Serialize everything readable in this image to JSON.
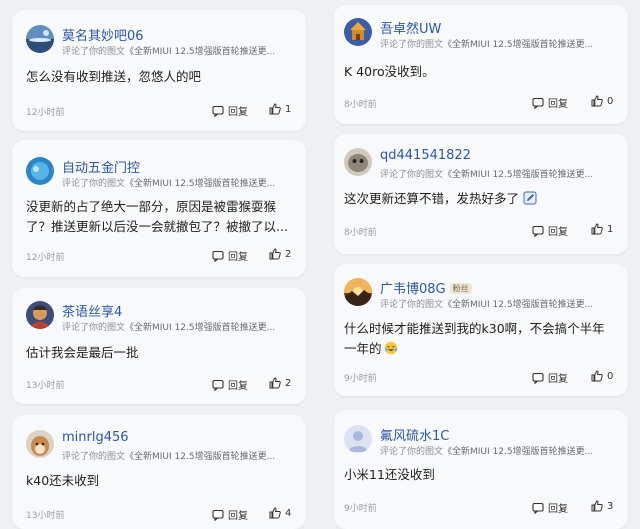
{
  "actions": {
    "reply_label": "回复"
  },
  "comments": [
    {
      "username": "莫名其妙吧06",
      "subline_prefix": "评论了你的图文",
      "subline_quote": "《全新MIUI 12.5增强版首轮推送更...",
      "text_lines": [
        "怎么没有收到推送，忽悠人的吧"
      ],
      "time": "12小时前",
      "likes": "1",
      "badge": ""
    },
    {
      "username": "吾卓然UW",
      "subline_prefix": "评论了你的图文",
      "subline_quote": "《全新MIUI 12.5增强版首轮推送更...",
      "text_lines": [
        "K 40ro没收到。"
      ],
      "time": "8小时前",
      "likes": "0",
      "badge": ""
    },
    {
      "username": "自动五金门控",
      "subline_prefix": "评论了你的图文",
      "subline_quote": "《全新MIUI 12.5增强版首轮推送更...",
      "text_lines": [
        "没更新的占了绝大一部分，原因是被雷猴耍猴",
        "了？推送更新以后没一会就撤包了？被撤了以..."
      ],
      "time": "12小时前",
      "likes": "2",
      "badge": ""
    },
    {
      "username": "qd441541822",
      "subline_prefix": "评论了你的图文",
      "subline_quote": "《全新MIUI 12.5增强版首轮推送更...",
      "text_lines": [
        "这次更新还算不错，发热好多了"
      ],
      "time": "8小时前",
      "likes": "1",
      "badge": ""
    },
    {
      "username": "茶语丝享4",
      "subline_prefix": "评论了你的图文",
      "subline_quote": "《全新MIUI 12.5增强版首轮推送更...",
      "text_lines": [
        "估计我会是最后一批"
      ],
      "time": "13小时前",
      "likes": "2",
      "badge": ""
    },
    {
      "username": "广韦博08G",
      "subline_prefix": "评论了你的图文",
      "subline_quote": "《全新MIUI 12.5增强版首轮推送更...",
      "text_lines": [
        "什么时候才能推送到我的k30啊，不会搞个半年",
        "一年的"
      ],
      "time": "9小时前",
      "likes": "0",
      "badge": "粉丝"
    },
    {
      "username": "minrlg456",
      "subline_prefix": "评论了你的图文",
      "subline_quote": "《全新MIUI 12.5增强版首轮推送更...",
      "text_lines": [
        "k40还未收到"
      ],
      "time": "13小时前",
      "likes": "4",
      "badge": ""
    },
    {
      "username": "氟风硫水1C",
      "subline_prefix": "评论了你的图文",
      "subline_quote": "《全新MIUI 12.5增强版首轮推送更...",
      "text_lines": [
        "小米11还没收到"
      ],
      "time": "9小时前",
      "likes": "3",
      "badge": ""
    }
  ],
  "icons": {
    "reply": "reply-icon",
    "like": "thumbs-up-icon",
    "emoji_tears": "laughing-tears-emoji-icon",
    "edit": "edit-icon"
  },
  "colors": {
    "username": "#2b56a8",
    "background": "#eef0f4",
    "card": "#f8f9fb"
  }
}
